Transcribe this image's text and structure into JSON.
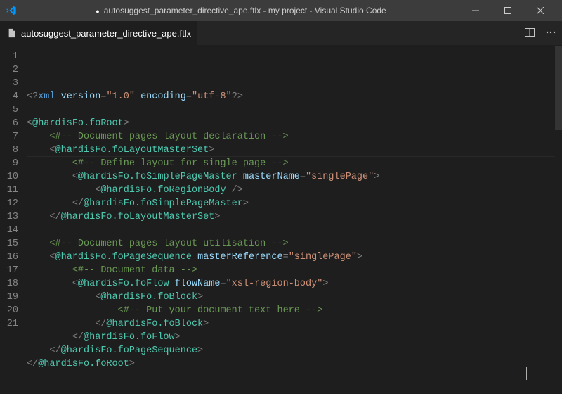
{
  "window": {
    "title": "autosuggest_parameter_directive_ape.ftlx - my project - Visual Studio Code",
    "dirty": true
  },
  "tab": {
    "filename": "autosuggest_parameter_directive_ape.ftlx",
    "dirty": true
  },
  "gutter": {
    "start": 1,
    "end": 21
  },
  "code": {
    "lines": [
      [
        [
          "bracket",
          "<?"
        ],
        [
          "pi",
          "xml"
        ],
        [
          "plain",
          " "
        ],
        [
          "attrname",
          "version"
        ],
        [
          "bracket",
          "="
        ],
        [
          "string",
          "\"1.0\""
        ],
        [
          "plain",
          " "
        ],
        [
          "attrname",
          "encoding"
        ],
        [
          "bracket",
          "="
        ],
        [
          "string",
          "\"utf-8\""
        ],
        [
          "bracket",
          "?>"
        ]
      ],
      [],
      [
        [
          "bracket",
          "<"
        ],
        [
          "tag",
          "@hardisFo.foRoot"
        ],
        [
          "bracket",
          ">"
        ]
      ],
      [
        [
          "plain",
          "    "
        ],
        [
          "comment",
          "<#-- Document pages layout declaration -->"
        ]
      ],
      [
        [
          "plain",
          "    "
        ],
        [
          "bracket",
          "<"
        ],
        [
          "tag",
          "@hardisFo.foLayoutMasterSet"
        ],
        [
          "bracket",
          ">"
        ]
      ],
      [
        [
          "plain",
          "        "
        ],
        [
          "comment",
          "<#-- Define layout for single page -->"
        ]
      ],
      [
        [
          "plain",
          "        "
        ],
        [
          "bracket",
          "<"
        ],
        [
          "tag",
          "@hardisFo.foSimplePageMaster"
        ],
        [
          "plain",
          " "
        ],
        [
          "attrname",
          "masterName"
        ],
        [
          "bracket",
          "="
        ],
        [
          "string",
          "\"singlePage\""
        ],
        [
          "bracket",
          ">"
        ]
      ],
      [
        [
          "plain",
          "            "
        ],
        [
          "bracket",
          "<"
        ],
        [
          "tag",
          "@hardisFo.foRegionBody"
        ],
        [
          "plain",
          " "
        ],
        [
          "bracket",
          "/>"
        ]
      ],
      [
        [
          "plain",
          "        "
        ],
        [
          "bracket",
          "</"
        ],
        [
          "tag",
          "@hardisFo.foSimplePageMaster"
        ],
        [
          "bracket",
          ">"
        ]
      ],
      [
        [
          "plain",
          "    "
        ],
        [
          "bracket",
          "</"
        ],
        [
          "tag",
          "@hardisFo.foLayoutMasterSet"
        ],
        [
          "bracket",
          ">"
        ]
      ],
      [],
      [
        [
          "plain",
          "    "
        ],
        [
          "comment",
          "<#-- Document pages layout utilisation -->"
        ]
      ],
      [
        [
          "plain",
          "    "
        ],
        [
          "bracket",
          "<"
        ],
        [
          "tag",
          "@hardisFo.foPageSequence"
        ],
        [
          "plain",
          " "
        ],
        [
          "attrname",
          "masterReference"
        ],
        [
          "bracket",
          "="
        ],
        [
          "string",
          "\"singlePage\""
        ],
        [
          "bracket",
          ">"
        ]
      ],
      [
        [
          "plain",
          "        "
        ],
        [
          "comment",
          "<#-- Document data -->"
        ]
      ],
      [
        [
          "plain",
          "        "
        ],
        [
          "bracket",
          "<"
        ],
        [
          "tag",
          "@hardisFo.foFlow"
        ],
        [
          "plain",
          " "
        ],
        [
          "attrname",
          "flowName"
        ],
        [
          "bracket",
          "="
        ],
        [
          "string",
          "\"xsl-region-body\""
        ],
        [
          "bracket",
          ">"
        ]
      ],
      [
        [
          "plain",
          "            "
        ],
        [
          "bracket",
          "<"
        ],
        [
          "tag",
          "@hardisFo.foBlock"
        ],
        [
          "bracket",
          ">"
        ]
      ],
      [
        [
          "plain",
          "                "
        ],
        [
          "comment",
          "<#-- Put your document text here -->"
        ]
      ],
      [
        [
          "plain",
          "            "
        ],
        [
          "bracket",
          "</"
        ],
        [
          "tag",
          "@hardisFo.foBlock"
        ],
        [
          "bracket",
          ">"
        ]
      ],
      [
        [
          "plain",
          "        "
        ],
        [
          "bracket",
          "</"
        ],
        [
          "tag",
          "@hardisFo.foFlow"
        ],
        [
          "bracket",
          ">"
        ]
      ],
      [
        [
          "plain",
          "    "
        ],
        [
          "bracket",
          "</"
        ],
        [
          "tag",
          "@hardisFo.foPageSequence"
        ],
        [
          "bracket",
          ">"
        ]
      ],
      [
        [
          "bracket",
          "</"
        ],
        [
          "tag",
          "@hardisFo.foRoot"
        ],
        [
          "bracket",
          ">"
        ]
      ]
    ],
    "active_line_index": 7
  },
  "colors": {
    "bg": "#1e1e1e",
    "titlebar": "#3c3c3c",
    "tabbar": "#252526"
  }
}
